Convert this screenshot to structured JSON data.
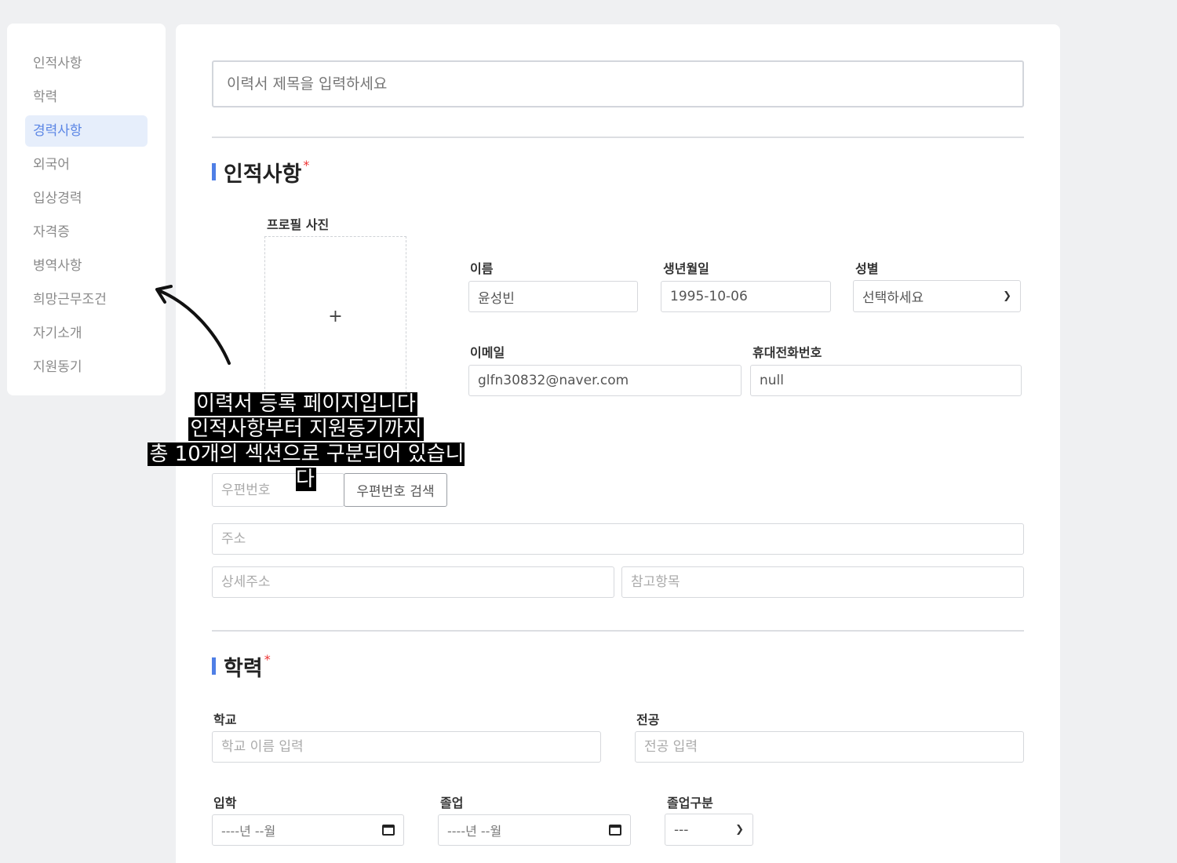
{
  "sidebar": {
    "items": [
      {
        "label": "인적사항"
      },
      {
        "label": "학력"
      },
      {
        "label": "경력사항"
      },
      {
        "label": "외국어"
      },
      {
        "label": "입상경력"
      },
      {
        "label": "자격증"
      },
      {
        "label": "병역사항"
      },
      {
        "label": "희망근무조건"
      },
      {
        "label": "자기소개"
      },
      {
        "label": "지원동기"
      }
    ],
    "active_index": 2
  },
  "form": {
    "title_placeholder": "이력서 제목을 입력하세요",
    "personal": {
      "section_title": "인적사항",
      "required_mark": "*",
      "photo_label": "프로필 사진",
      "photo_add": "+",
      "name_label": "이름",
      "name_value": "윤성빈",
      "birth_label": "생년월일",
      "birth_value": "1995-10-06",
      "gender_label": "성별",
      "gender_value": "선택하세요",
      "email_label": "이메일",
      "email_value": "glfn30832@naver.com",
      "phone_label": "휴대전화번호",
      "phone_value": "null",
      "zipcode_placeholder": "우편번호",
      "zipcode_button": "우편번호 검색",
      "address_placeholder": "주소",
      "address_detail_placeholder": "상세주소",
      "address_extra_placeholder": "참고항목"
    },
    "education": {
      "section_title": "학력",
      "required_mark": "*",
      "school_label": "학교",
      "school_placeholder": "학교 이름 입력",
      "major_label": "전공",
      "major_placeholder": "전공 입력",
      "admission_label": "입학",
      "admission_value": "----년 --월",
      "graduation_label": "졸업",
      "graduation_value": "----년 --월",
      "grad_type_label": "졸업구분",
      "grad_type_value": "---"
    }
  },
  "overlay": {
    "line1": "이력서 등록 페이지입니다",
    "line2": "인적사항부터 지원동기까지",
    "line3": "총 10개의 섹션으로 구분되어 있습니다"
  }
}
